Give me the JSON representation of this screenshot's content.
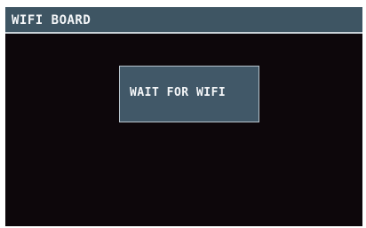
{
  "window": {
    "title": "WIFI BOARD"
  },
  "dialog": {
    "message": "WAIT FOR WIFI"
  },
  "colors": {
    "titlebar_bg": "#3e5563",
    "screen_bg": "#0d070b",
    "dialog_bg": "#415868",
    "dialog_border": "#b7c4cd",
    "text": "#f4f6f8"
  }
}
